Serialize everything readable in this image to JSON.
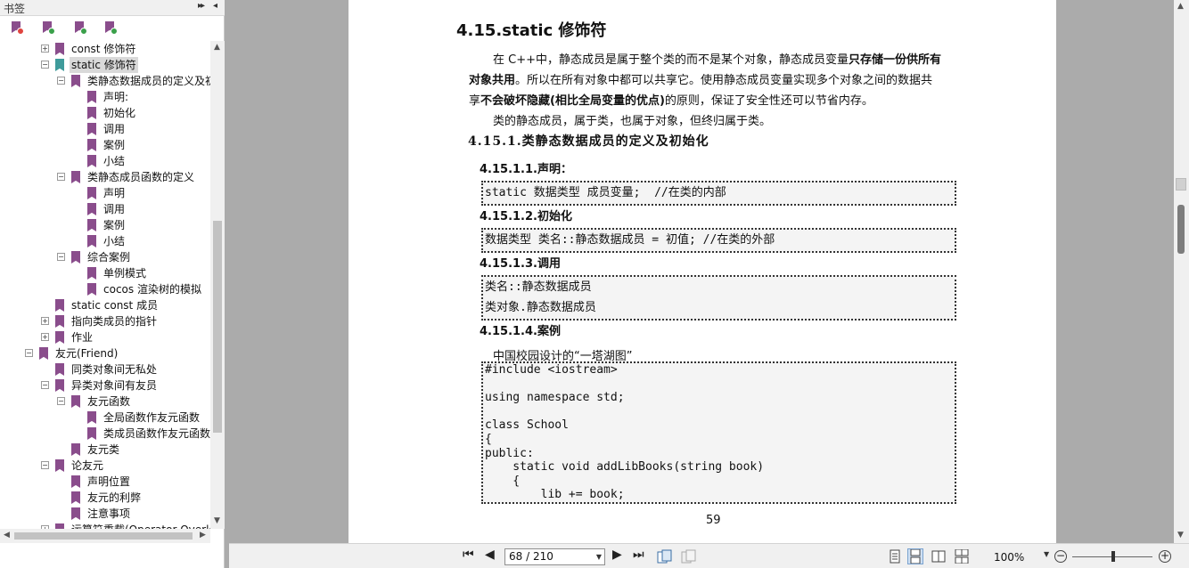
{
  "bookmark_panel": {
    "title": "书签",
    "collapse_glyph": "▸▸",
    "close_glyph": "◂",
    "toolbar_icons": [
      {
        "name": "bookmark-delete-icon",
        "color": "#e0443f"
      },
      {
        "name": "bookmark-add-icon",
        "color": "#3aa04a"
      },
      {
        "name": "bookmark-goto-icon",
        "color": "#3aa04a"
      },
      {
        "name": "bookmark-expand-icon",
        "color": "#3aa04a"
      }
    ],
    "items": [
      {
        "label": "const 修饰符",
        "exp": "+"
      },
      {
        "label": "static 修饰符",
        "exp": "-"
      },
      {
        "label": "类静态数据成员的定义及初始",
        "exp": "-"
      },
      {
        "label": "声明:",
        "exp": ""
      },
      {
        "label": "初始化",
        "exp": ""
      },
      {
        "label": "调用",
        "exp": ""
      },
      {
        "label": "案例",
        "exp": ""
      },
      {
        "label": "小结",
        "exp": ""
      },
      {
        "label": "类静态成员函数的定义",
        "exp": "-"
      },
      {
        "label": "声明",
        "exp": ""
      },
      {
        "label": "调用",
        "exp": ""
      },
      {
        "label": "案例",
        "exp": ""
      },
      {
        "label": "小结",
        "exp": ""
      },
      {
        "label": "综合案例",
        "exp": "-"
      },
      {
        "label": "单例模式",
        "exp": ""
      },
      {
        "label": "cocos 渲染树的模拟",
        "exp": ""
      },
      {
        "label": "static const 成员",
        "exp": ""
      },
      {
        "label": "指向类成员的指针",
        "exp": "+"
      },
      {
        "label": "作业",
        "exp": "+"
      },
      {
        "label": "友元(Friend)",
        "exp": "-"
      },
      {
        "label": "同类对象间无私处",
        "exp": ""
      },
      {
        "label": "异类对象间有友员",
        "exp": "-"
      },
      {
        "label": "友元函数",
        "exp": "-"
      },
      {
        "label": "全局函数作友元函数",
        "exp": ""
      },
      {
        "label": "类成员函数作友元函数",
        "exp": ""
      },
      {
        "label": "友元类",
        "exp": ""
      },
      {
        "label": "论友元",
        "exp": "-"
      },
      {
        "label": "声明位置",
        "exp": ""
      },
      {
        "label": "友元的利弊",
        "exp": ""
      },
      {
        "label": "注意事项",
        "exp": ""
      },
      {
        "label": "运算符重载(Operator Overload)",
        "exp": "+"
      }
    ],
    "selected_index": 1
  },
  "document": {
    "heading": "4.15.static  修饰符",
    "para1_line1_a": "在 C++中，静态成员是属于整个类的而不是某个对象，静态成员变量",
    "para1_line1_b": "只存储一份供所有",
    "para1_line2_a": "对象共用",
    "para1_line2_b": "。所以在所有对象中都可以共享它。使用静态成员变量实现多个对象之间的数据共",
    "para1_line3_a": "享",
    "para1_line3_b": "不会破坏隐藏(相比全局变量的优点)",
    "para1_line3_c": "的原则，保证了安全性还可以节省内存。",
    "para2": "类的静态成员，属于类，也属于对象，但终归属于类。",
    "sec_4_15_1": "4.15.1.类静态数据成员的定义及初始化",
    "sec_decl": "4.15.1.1.声明：",
    "code_decl": "static 数据类型 成员变量;  //在类的内部",
    "sec_init": "4.15.1.2.初始化",
    "code_init": "数据类型 类名::静态数据成员 = 初值; //在类的外部",
    "sec_call": "4.15.1.3.调用",
    "code_call": [
      "类名::静态数据成员",
      "类对象.静态数据成员"
    ],
    "sec_case": "4.15.1.4.案例",
    "case_caption": "中国校园设计的“一塔湖图”",
    "code_case": [
      "#include <iostream>",
      "",
      "using namespace std;",
      "",
      "class School",
      "{",
      "public:",
      "    static void addLibBooks(string book)",
      "    {",
      "        lib += book;"
    ],
    "page_number": "59"
  },
  "bottom_bar": {
    "page_field": "68 / 210",
    "zoom": "100%",
    "icons": [
      "first-page-icon",
      "prev-page-icon",
      "next-page-icon",
      "last-page-icon",
      "prev-view-icon",
      "next-view-icon",
      "single-page-icon",
      "continuous-page-icon",
      "facing-page-icon",
      "continuous-facing-icon"
    ]
  },
  "colors": {
    "bookmark": "#8a4d8c",
    "bookmark_selected": "#3f9b9b",
    "doc_background": "#ababab",
    "selection": "#d9d9d9"
  }
}
